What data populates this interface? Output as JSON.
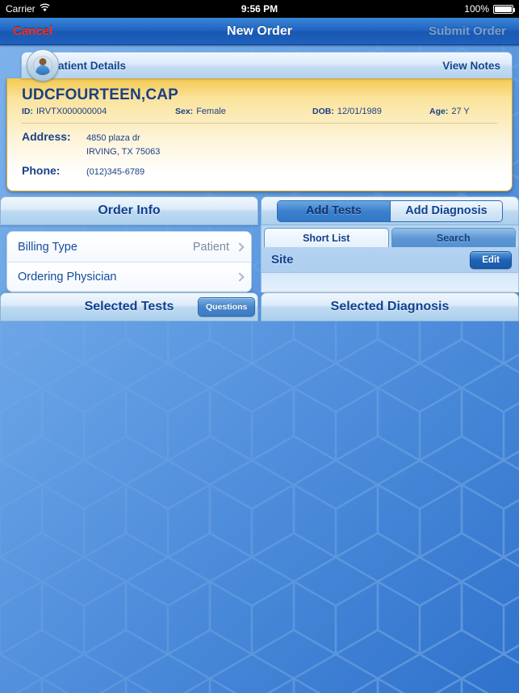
{
  "status_bar": {
    "carrier": "Carrier",
    "wifi_icon": "wifi-icon",
    "time": "9:56 PM",
    "battery_percent": "100%",
    "battery_icon": "battery-full-icon"
  },
  "nav_bar": {
    "cancel_label": "Cancel",
    "title": "New Order",
    "submit_label": "Submit Order"
  },
  "patient_header": {
    "avatar_icon": "patient-avatar-icon",
    "title": "Patient Details",
    "view_notes_label": "View Notes"
  },
  "patient_card": {
    "name": "UDCFOURTEEN,CAP",
    "id_label": "ID:",
    "id_value": "IRVTX000000004",
    "sex_label": "Sex:",
    "sex_value": "Female",
    "dob_label": "DOB:",
    "dob_value": "12/01/1989",
    "age_label": "Age:",
    "age_value": "27 Y",
    "address_label": "Address:",
    "address_line1": "4850 plaza dr",
    "address_line2": "IRVING, TX 75063",
    "phone_label": "Phone:",
    "phone_value": "(012)345-6789"
  },
  "order_info": {
    "panel_title": "Order Info",
    "rows": [
      {
        "label": "Billing Type",
        "value": "Patient",
        "chevron_icon": "chevron-right-icon"
      },
      {
        "label": "Ordering Physician",
        "value": "",
        "chevron_icon": "chevron-right-icon"
      }
    ]
  },
  "right_panel": {
    "segments": [
      {
        "label": "Add Tests",
        "selected": true
      },
      {
        "label": "Add Diagnosis",
        "selected": false
      }
    ],
    "tabs": [
      {
        "label": "Short List",
        "active": true
      },
      {
        "label": "Search",
        "active": false
      }
    ],
    "site_label": "Site",
    "edit_label": "Edit"
  },
  "bottom": {
    "selected_tests_label": "Selected Tests",
    "questions_label": "Questions",
    "selected_diagnosis_label": "Selected Diagnosis"
  },
  "colors": {
    "cancel_red": "#ff2d16",
    "nav_blue": "#1f63c0",
    "panel_title_blue": "#11418b",
    "card_yellow": "#f4c950",
    "accent_button_blue": "#1d62b6"
  }
}
